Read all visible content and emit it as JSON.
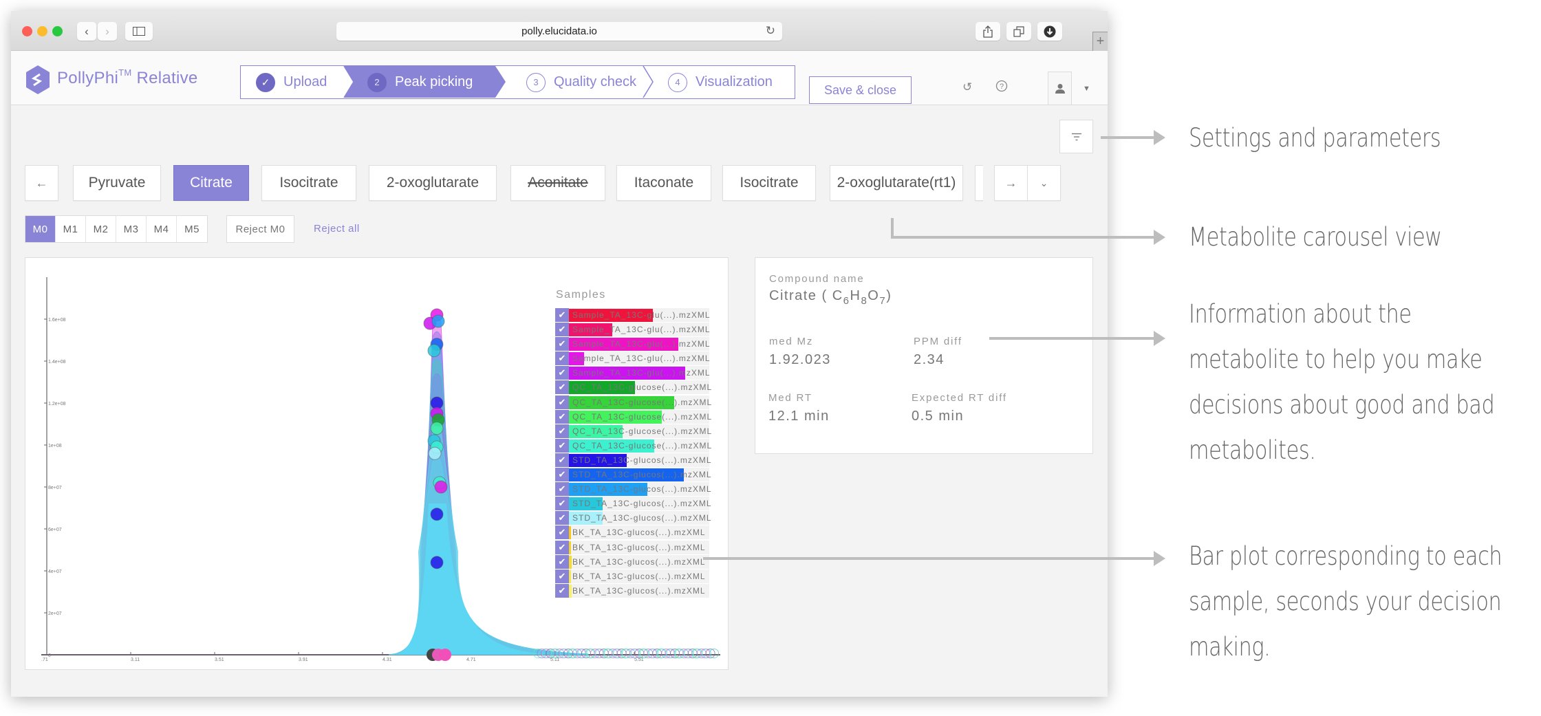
{
  "browser": {
    "url": "polly.elucidata.io",
    "new_tab_label": "+"
  },
  "app": {
    "brand_name": "PollyPhi",
    "brand_tm": "TM",
    "brand_suffix": " Relative",
    "steps": [
      {
        "number": "✓",
        "label": "Upload",
        "state": "done"
      },
      {
        "number": "2",
        "label": "Peak picking",
        "state": "active"
      },
      {
        "number": "3",
        "label": "Quality check",
        "state": "pending"
      },
      {
        "number": "4",
        "label": "Visualization",
        "state": "pending"
      }
    ],
    "save_close_label": "Save & close",
    "accent_color": "#8a84d6"
  },
  "carousel": {
    "prev_icon": "←",
    "next_icon": "→",
    "dropdown_icon": "⌄",
    "metabolites": [
      {
        "label": "Pyruvate",
        "state": "normal"
      },
      {
        "label": "Citrate",
        "state": "active"
      },
      {
        "label": "Isocitrate",
        "state": "normal"
      },
      {
        "label": "2-oxoglutarate",
        "state": "normal"
      },
      {
        "label": "Aconitate",
        "state": "rejected"
      },
      {
        "label": "Itaconate",
        "state": "normal"
      },
      {
        "label": "Isocitrate",
        "state": "normal"
      },
      {
        "label": "2-oxoglutarate(rt1)",
        "state": "normal"
      }
    ]
  },
  "isotopes": {
    "tabs": [
      "M0",
      "M1",
      "M2",
      "M3",
      "M4",
      "M5"
    ],
    "active": "M0",
    "reject_m0_label": "Reject M0",
    "reject_all_label": "Reject all"
  },
  "legend": {
    "title": "Samples",
    "items": [
      {
        "label": "Sample_TA_13C-glu(...).mzXML",
        "color": "#f0143c",
        "fraction": 0.6,
        "checked": true
      },
      {
        "label": "Sample_TA_13C-glu(...).mzXML",
        "color": "#f0146e",
        "fraction": 0.31,
        "checked": true
      },
      {
        "label": "Sample_TA_13C-glu(...).mzXML",
        "color": "#ee14c4",
        "fraction": 0.78,
        "checked": true
      },
      {
        "label": "Sample_TA_13C-glu(...).mzXML",
        "color": "#e614e8",
        "fraction": 0.11,
        "checked": true
      },
      {
        "label": "Sample_TA_13C-glu(...).mzXML",
        "color": "#cc14f0",
        "fraction": 0.83,
        "checked": true
      },
      {
        "label": "QC_TA_13C-glucose(...).mzXML",
        "color": "#13a82a",
        "fraction": 0.47,
        "checked": true
      },
      {
        "label": "QC_TA_13C-glucose(...).mzXML",
        "color": "#36d43a",
        "fraction": 0.75,
        "checked": true
      },
      {
        "label": "QC_TA_13C-glucose(...).mzXML",
        "color": "#44f25c",
        "fraction": 0.66,
        "checked": true
      },
      {
        "label": "QC_TA_13C-glucose(...).mzXML",
        "color": "#3cf5a4",
        "fraction": 0.38,
        "checked": true
      },
      {
        "label": "QC_TA_13C-glucose(...).mzXML",
        "color": "#3cf0d0",
        "fraction": 0.61,
        "checked": true
      },
      {
        "label": "STD_TA_13C-glucos(...).mzXML",
        "color": "#2414e6",
        "fraction": 0.41,
        "checked": true
      },
      {
        "label": "STD_TA_13C-glucos(...).mzXML",
        "color": "#1464f0",
        "fraction": 0.82,
        "checked": true
      },
      {
        "label": "STD_TA_13C-glucos(...).mzXML",
        "color": "#1ea0f5",
        "fraction": 0.56,
        "checked": true
      },
      {
        "label": "STD_TA_13C-glucos(...).mzXML",
        "color": "#28c8dc",
        "fraction": 0.24,
        "checked": true
      },
      {
        "label": "STD_TA_13C-glucos(...).mzXML",
        "color": "#a8f0fa",
        "fraction": 0.24,
        "checked": true
      },
      {
        "label": "BK_TA_13C-glucos(...).mzXML",
        "color": "#f5c814",
        "fraction": 0.01,
        "checked": true
      },
      {
        "label": "BK_TA_13C-glucos(...).mzXML",
        "color": "#f5d228",
        "fraction": 0.01,
        "checked": true
      },
      {
        "label": "BK_TA_13C-glucos(...).mzXML",
        "color": "#f5dc28",
        "fraction": 0.02,
        "checked": true
      },
      {
        "label": "BK_TA_13C-glucos(...).mzXML",
        "color": "#f5e650",
        "fraction": 0.01,
        "checked": true
      },
      {
        "label": "BK_TA_13C-glucos(...).mzXML",
        "color": "#faf064",
        "fraction": 0.02,
        "checked": true
      }
    ]
  },
  "chart_data": {
    "type": "area",
    "title": "",
    "xlabel": "",
    "ylabel": "",
    "x_tick_labels": [
      ".71",
      "3.11",
      "3.51",
      "3.91",
      "4.31",
      "4.71",
      "5.11",
      "5.51"
    ],
    "y_tick_labels": [
      "0",
      "2e+07",
      "4e+07",
      "6e+07",
      "8e+07",
      "1e+08",
      "1.2e+08",
      "1.4e+08",
      "1.6e+08"
    ],
    "xlim": [
      2.71,
      5.91
    ],
    "ylim": [
      0,
      180000000.0
    ],
    "peak_rt": 4.55,
    "peak_apex_points": [
      {
        "sample": 3,
        "y": 162000000.0
      },
      {
        "sample": 4,
        "y": 158000000.0
      },
      {
        "sample": 12,
        "y": 159000000.0
      },
      {
        "sample": 11,
        "y": 148000000.0
      },
      {
        "sample": 13,
        "y": 145000000.0
      },
      {
        "sample": 10,
        "y": 120000000.0
      },
      {
        "sample": 4,
        "y": 115000000.0
      },
      {
        "sample": 5,
        "y": 112000000.0
      },
      {
        "sample": 8,
        "y": 108000000.0
      },
      {
        "sample": 13,
        "y": 102000000.0
      },
      {
        "sample": 9,
        "y": 99000000.0
      },
      {
        "sample": 14,
        "y": 96000000.0
      },
      {
        "sample": 9,
        "y": 82000000.0
      },
      {
        "sample": 3,
        "y": 80000000.0
      },
      {
        "sample": 10,
        "y": 67000000.0
      },
      {
        "sample": 10,
        "y": 44000000.0
      }
    ],
    "legend_position": "top-right"
  },
  "info": {
    "compound_label": "Compound name",
    "compound_name": "Citrate ( ",
    "formula": [
      {
        "el": "C",
        "n": "6"
      },
      {
        "el": "H",
        "n": "8"
      },
      {
        "el": "O",
        "n": "7"
      }
    ],
    "formula_close": ")",
    "med_mz_label": "med Mz",
    "med_mz_value": "1.92.023",
    "ppm_label": "PPM diff",
    "ppm_value": "2.34",
    "med_rt_label": "Med RT",
    "med_rt_value": "12.1 min",
    "rt_diff_label": "Expected RT diff",
    "rt_diff_value": "0.5 min"
  },
  "annotations": {
    "settings": "Settings and parameters",
    "carousel": "Metabolite carousel view",
    "info": [
      "Information about the",
      "metabolite to help you make",
      "decisions about good and bad",
      "metabolites."
    ],
    "barplot": [
      "Bar plot corresponding to each",
      "sample, seconds your decision",
      "making."
    ]
  }
}
